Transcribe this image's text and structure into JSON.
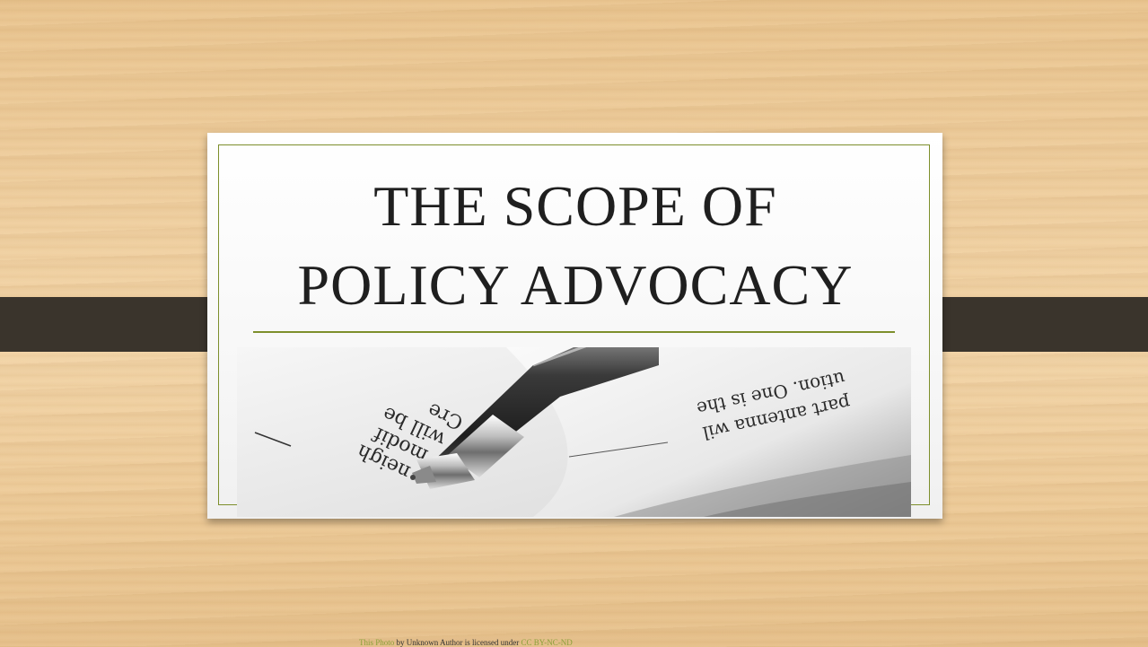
{
  "slide": {
    "title_line1": "THE SCOPE OF",
    "title_line2": "POLICY ADVOCACY"
  },
  "photo": {
    "icon": "pen-on-book-photo",
    "text_left": [
      "neigh",
      "modif",
      "will be",
      "Cre"
    ],
    "text_right": [
      "part antenna wil",
      "ution. One is the"
    ]
  },
  "credit": {
    "link1": "This Photo",
    "middle": " by Unknown Author is licensed under ",
    "link2": "CC BY-NC-ND"
  },
  "colors": {
    "accent": "#7d8f2c",
    "band": "#3a342c",
    "title": "#1f1f1f"
  }
}
